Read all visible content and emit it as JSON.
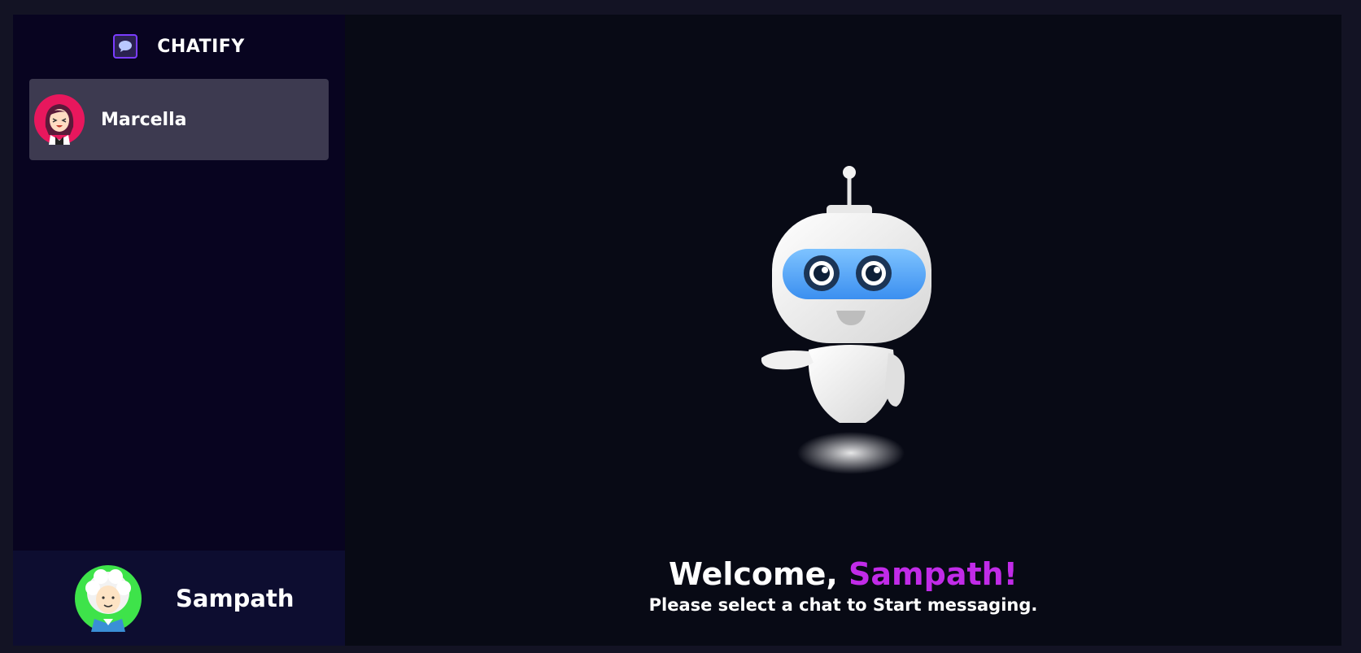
{
  "brand": {
    "name": "CHATIFY",
    "logo_icon": "chat-bubble-icon"
  },
  "contacts": [
    {
      "name": "Marcella",
      "avatar_icon": "woman-avatar-icon",
      "selected": true
    }
  ],
  "current_user": {
    "name": "Sampath",
    "avatar_icon": "man-avatar-icon"
  },
  "welcome": {
    "greeting": "Welcome,",
    "username": "Sampath!",
    "subtitle": "Please select a chat to Start messaging.",
    "illustration_icon": "robot-illustration"
  },
  "colors": {
    "accent": "#c12be8",
    "sidebar_bg": "#080420",
    "contact_selected_bg": "#3d3a50",
    "main_bg": "#080a15"
  }
}
